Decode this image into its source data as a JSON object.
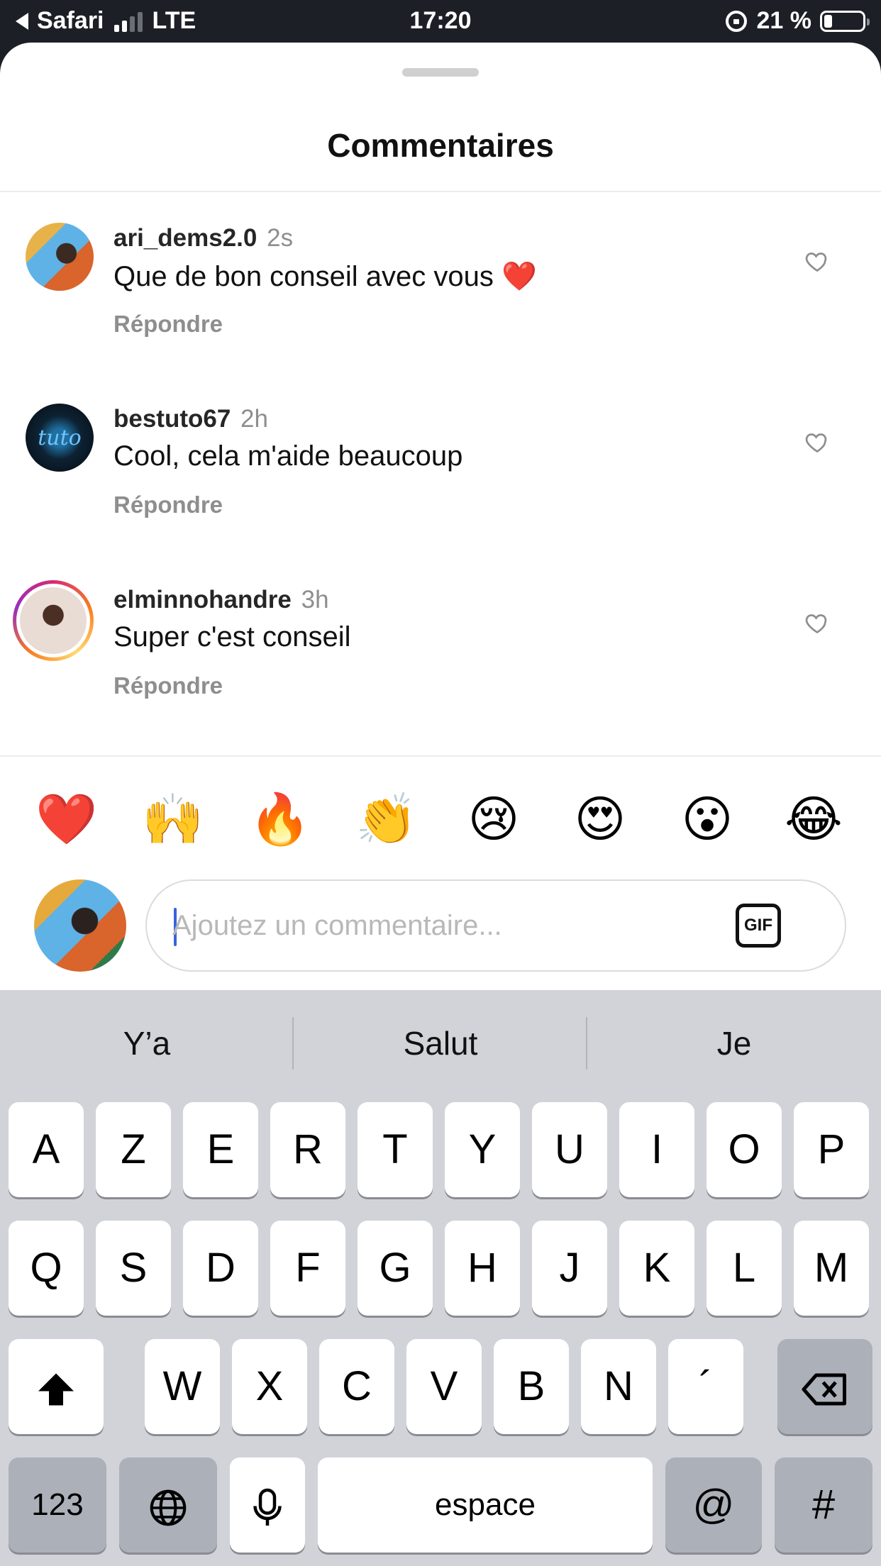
{
  "status_bar": {
    "back_app": "Safari",
    "network": "LTE",
    "time": "17:20",
    "battery_text": "21 %",
    "battery_level": 0.21
  },
  "sheet": {
    "title": "Commentaires"
  },
  "comments": [
    {
      "username": "ari_dems2.0",
      "age": "2s",
      "text": "Que de bon conseil avec vous ❤️",
      "reply": "Répondre"
    },
    {
      "username": "bestuto67",
      "age": "2h",
      "text": "Cool, cela m'aide beaucoup",
      "reply": "Répondre",
      "avatar_text": "tuto"
    },
    {
      "username": "elminnohandre",
      "age": "3h",
      "text": "Super c'est conseil",
      "reply": "Répondre"
    }
  ],
  "emoji_reactions": [
    "❤️",
    "🙌",
    "🔥",
    "👏",
    "😢",
    "😍",
    "😮",
    "😂"
  ],
  "composer": {
    "placeholder": "Ajoutez un commentaire...",
    "value": "",
    "gif_label": "GIF"
  },
  "keyboard": {
    "predictions": [
      "Y’a",
      "Salut",
      "Je"
    ],
    "row1": [
      "A",
      "Z",
      "E",
      "R",
      "T",
      "Y",
      "U",
      "I",
      "O",
      "P"
    ],
    "row2": [
      "Q",
      "S",
      "D",
      "F",
      "G",
      "H",
      "J",
      "K",
      "L",
      "M"
    ],
    "row3": [
      "W",
      "X",
      "C",
      "V",
      "B",
      "N",
      "´"
    ],
    "numbers_key": "123",
    "space_key": "espace",
    "at_key": "@",
    "hash_key": "#",
    "icons": {
      "shift": "shift-icon",
      "backspace": "backspace-icon",
      "globe": "globe-icon",
      "mic": "microphone-icon"
    }
  }
}
